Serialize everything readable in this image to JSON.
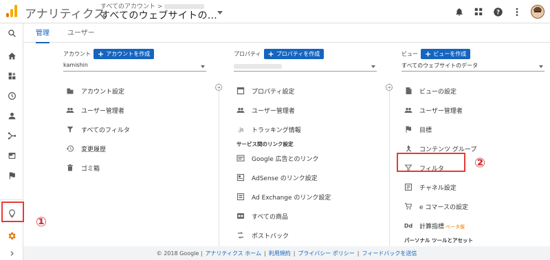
{
  "header": {
    "app_title": "アナリティクス",
    "breadcrumb": "すべてのアカウント >",
    "property_name": "すべてのウェブサイトの..."
  },
  "tabs": [
    {
      "label": "管理",
      "active": true
    },
    {
      "label": "ユーザー",
      "active": false
    }
  ],
  "columns": {
    "account": {
      "label": "アカウント",
      "create_label": "アカウントを作成",
      "selected": "kamishin",
      "items": [
        {
          "icon": "building-icon",
          "label": "アカウント設定"
        },
        {
          "icon": "users-icon",
          "label": "ユーザー管理者"
        },
        {
          "icon": "filter-icon",
          "label": "すべてのフィルタ"
        },
        {
          "icon": "history-icon",
          "label": "変更履歴"
        },
        {
          "icon": "trash-icon",
          "label": "ゴミ箱"
        }
      ]
    },
    "property": {
      "label": "プロパティ",
      "create_label": "プロパティを作成",
      "items": [
        {
          "icon": "property-settings-icon",
          "label": "プロパティ設定"
        },
        {
          "icon": "users-icon",
          "label": "ユーザー管理者"
        },
        {
          "icon": "js-icon",
          "label": "トラッキング情報",
          "icon_text": ".js"
        }
      ],
      "links_heading": "サービス間のリンク設定",
      "link_items": [
        {
          "icon": "google-ads-icon",
          "label": "Google 広告とのリンク"
        },
        {
          "icon": "adsense-icon",
          "label": "AdSense のリンク設定"
        },
        {
          "icon": "ad-exchange-icon",
          "label": "Ad Exchange のリンク設定"
        },
        {
          "icon": "products-icon",
          "label": "すべての商品"
        },
        {
          "icon": "postback-icon",
          "label": "ポストバック"
        }
      ]
    },
    "view": {
      "label": "ビュー",
      "create_label": "ビューを作成",
      "selected": "すべてのウェブサイトのデータ",
      "items": [
        {
          "icon": "document-icon",
          "label": "ビューの設定"
        },
        {
          "icon": "users-icon",
          "label": "ユーザー管理者"
        },
        {
          "icon": "flag-icon",
          "label": "目標"
        },
        {
          "icon": "content-group-icon",
          "label": "コンテンツ グループ"
        },
        {
          "icon": "filter-icon",
          "label": "フィルタ"
        },
        {
          "icon": "channel-icon",
          "label": "チャネル設定"
        },
        {
          "icon": "cart-icon",
          "label": "e コマースの設定"
        },
        {
          "icon": "dd-icon",
          "label": "計算指標",
          "icon_text": "Dd",
          "badge": "ベータ版"
        }
      ],
      "tools_heading": "パーソナル ツールとアセット"
    }
  },
  "annotations": {
    "gear": "①",
    "filter": "②"
  },
  "footer": {
    "copyright": "© 2018 Google |",
    "links": [
      "アナリティクス ホーム",
      "利用規約",
      "プライバシー ポリシー",
      "フィードバックを送信"
    ]
  },
  "colors": {
    "accent": "#1565c0",
    "annotation": "#e53935"
  }
}
